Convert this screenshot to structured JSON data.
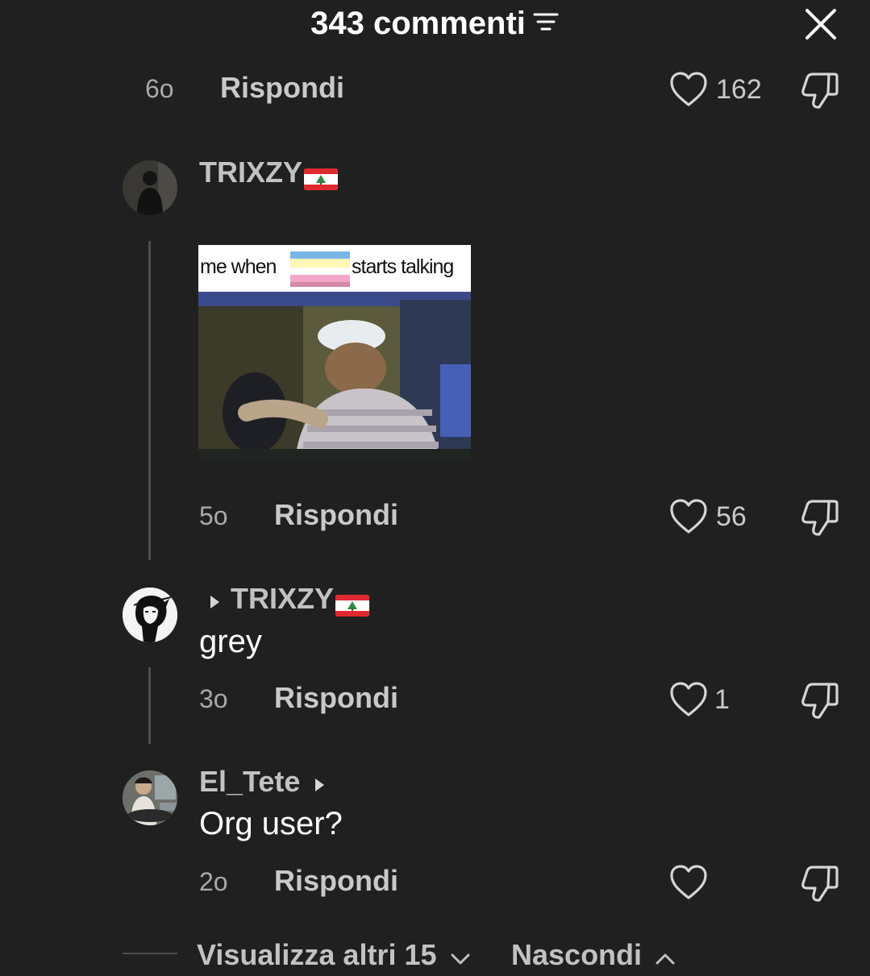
{
  "header": {
    "title": "343 commenti",
    "filter_icon": "filter-icon",
    "close_icon": "close-icon"
  },
  "top_comment_footer": {
    "time": "6o",
    "reply": "Rispondi",
    "likes": "162"
  },
  "comments": [
    {
      "username": "TRIXZY",
      "flag": "lebanon-flag",
      "meme": {
        "left_text": "me when",
        "right_text": "starts talking"
      },
      "time": "5o",
      "reply": "Rispondi",
      "likes": "56"
    },
    {
      "reply_to": "TRIXZY",
      "flag": "lebanon-flag",
      "text": "grey",
      "time": "3o",
      "reply": "Rispondi",
      "likes": "1"
    },
    {
      "username": "El_Tete",
      "text": "Org user?",
      "time": "2o",
      "reply": "Rispondi",
      "likes": ""
    }
  ],
  "footer": {
    "show_more": "Visualizza altri 15",
    "hide": "Nascondi"
  },
  "colors": {
    "background": "#202021",
    "text": "#ffffff",
    "muted": "#a9a9a9",
    "thread_line": "#4e4e4e"
  }
}
